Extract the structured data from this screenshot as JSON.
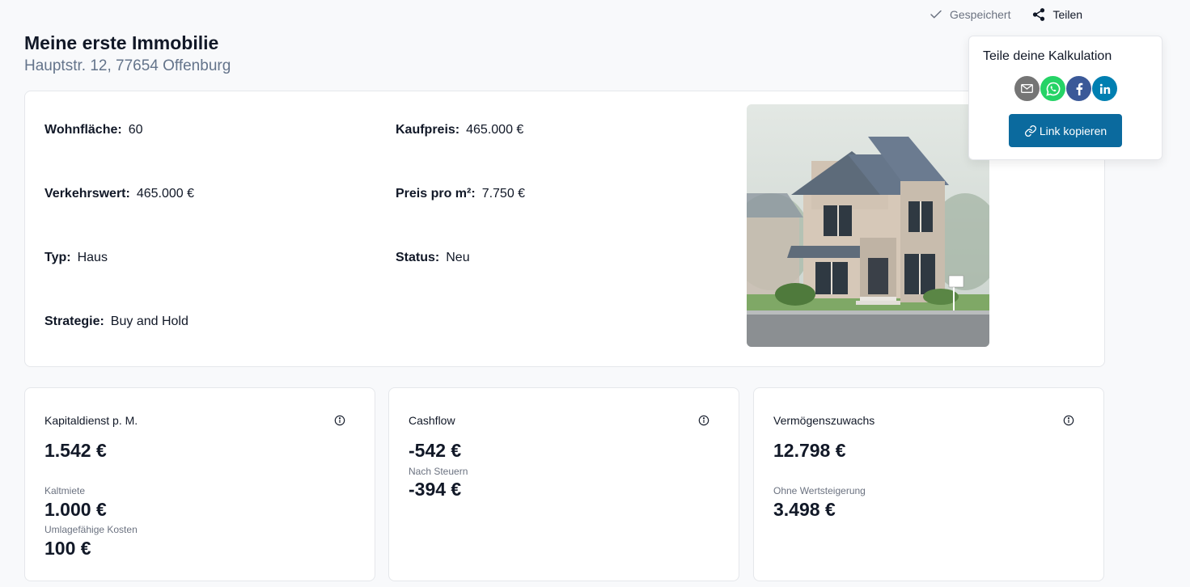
{
  "top_actions": {
    "saved_label": "Gespeichert",
    "share_label": "Teilen"
  },
  "property": {
    "title": "Meine erste Immobilie",
    "address": "Hauptstr. 12, 77654 Offenburg",
    "image_icon": "house-photo",
    "fields": {
      "wohnflaeche": {
        "label": "Wohnfläche:",
        "value": "60"
      },
      "kaufpreis": {
        "label": "Kaufpreis:",
        "value": "465.000 €"
      },
      "verkehrswert": {
        "label": "Verkehrswert:",
        "value": "465.000 €"
      },
      "preis_pro_m2": {
        "label": "Preis pro m²:",
        "value": "7.750 €"
      },
      "typ": {
        "label": "Typ:",
        "value": "Haus"
      },
      "status": {
        "label": "Status:",
        "value": "Neu"
      },
      "strategie": {
        "label": "Strategie:",
        "value": "Buy and Hold"
      }
    }
  },
  "metrics": {
    "kapitaldienst": {
      "title": "Kapitaldienst p. M.",
      "value": "1.542 €",
      "sub1_label": "Kaltmiete",
      "sub1_value": "1.000 €",
      "sub2_label": "Umlagefähige Kosten",
      "sub2_value": "100 €"
    },
    "cashflow": {
      "title": "Cashflow",
      "value": "-542 €",
      "sub1_label": "Nach Steuern",
      "sub1_value": "-394 €"
    },
    "vermoegenszuwachs": {
      "title": "Vermögenszuwachs",
      "value": "12.798 €",
      "sub1_label": "Ohne Wertsteigerung",
      "sub1_value": "3.498 €"
    }
  },
  "share_popover": {
    "title": "Teile deine Kalkulation",
    "copy_label": "Link kopieren",
    "social": [
      {
        "name": "email",
        "icon": "mail-icon",
        "color": "#757575"
      },
      {
        "name": "whatsapp",
        "icon": "whatsapp-icon",
        "color": "#25d366"
      },
      {
        "name": "facebook",
        "icon": "facebook-icon",
        "color": "#3b5998"
      },
      {
        "name": "linkedin",
        "icon": "linkedin-icon",
        "color": "#007fb1"
      }
    ]
  },
  "colors": {
    "primary": "#0b6a9e",
    "muted_text": "#64748b",
    "border": "#e5e7eb"
  }
}
